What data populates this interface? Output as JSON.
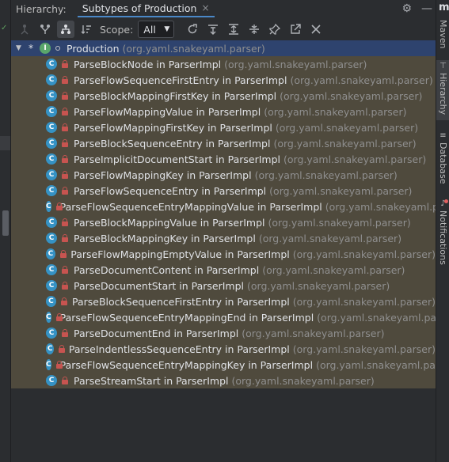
{
  "header": {
    "title_label": "Hierarchy:",
    "tab_label": "Subtypes of Production",
    "tab_close": "×",
    "settings_glyph": "⚙",
    "minimize_glyph": "—"
  },
  "toolbar": {
    "scope_label": "Scope:",
    "scope_value": "All",
    "scope_arrow": "▼"
  },
  "tree": {
    "root": {
      "name": "Production",
      "package": "(org.yaml.snakeyaml.parser)",
      "kind_letter": "I"
    },
    "class_letter": "C",
    "children": [
      {
        "name": "ParseBlockNode in ParserImpl",
        "package": "(org.yaml.snakeyaml.parser)"
      },
      {
        "name": "ParseFlowSequenceFirstEntry in ParserImpl",
        "package": "(org.yaml.snakeyaml.parser)"
      },
      {
        "name": "ParseBlockMappingFirstKey in ParserImpl",
        "package": "(org.yaml.snakeyaml.parser)"
      },
      {
        "name": "ParseFlowMappingValue in ParserImpl",
        "package": "(org.yaml.snakeyaml.parser)"
      },
      {
        "name": "ParseFlowMappingFirstKey in ParserImpl",
        "package": "(org.yaml.snakeyaml.parser)"
      },
      {
        "name": "ParseBlockSequenceEntry in ParserImpl",
        "package": "(org.yaml.snakeyaml.parser)"
      },
      {
        "name": "ParseImplicitDocumentStart in ParserImpl",
        "package": "(org.yaml.snakeyaml.parser)"
      },
      {
        "name": "ParseFlowMappingKey in ParserImpl",
        "package": "(org.yaml.snakeyaml.parser)"
      },
      {
        "name": "ParseFlowSequenceEntry in ParserImpl",
        "package": "(org.yaml.snakeyaml.parser)"
      },
      {
        "name": "ParseFlowSequenceEntryMappingValue in ParserImpl",
        "package": "(org.yaml.snakeyaml.pars"
      },
      {
        "name": "ParseBlockMappingValue in ParserImpl",
        "package": "(org.yaml.snakeyaml.parser)"
      },
      {
        "name": "ParseBlockMappingKey in ParserImpl",
        "package": "(org.yaml.snakeyaml.parser)"
      },
      {
        "name": "ParseFlowMappingEmptyValue in ParserImpl",
        "package": "(org.yaml.snakeyaml.parser)"
      },
      {
        "name": "ParseDocumentContent in ParserImpl",
        "package": "(org.yaml.snakeyaml.parser)"
      },
      {
        "name": "ParseDocumentStart in ParserImpl",
        "package": "(org.yaml.snakeyaml.parser)"
      },
      {
        "name": "ParseBlockSequenceFirstEntry in ParserImpl",
        "package": "(org.yaml.snakeyaml.parser)"
      },
      {
        "name": "ParseFlowSequenceEntryMappingEnd in ParserImpl",
        "package": "(org.yaml.snakeyaml.parse"
      },
      {
        "name": "ParseDocumentEnd in ParserImpl",
        "package": "(org.yaml.snakeyaml.parser)"
      },
      {
        "name": "ParseIndentlessSequenceEntry in ParserImpl",
        "package": "(org.yaml.snakeyaml.parser)"
      },
      {
        "name": "ParseFlowSequenceEntryMappingKey in ParserImpl",
        "package": "(org.yaml.snakeyaml.parse"
      },
      {
        "name": "ParseStreamStart in ParserImpl",
        "package": "(org.yaml.snakeyaml.parser)"
      }
    ]
  },
  "right_sidebar": {
    "top_label": "m",
    "items": [
      {
        "label": "Maven",
        "icon": "maven-icon"
      },
      {
        "label": "Hierarchy",
        "icon": "hierarchy-icon"
      },
      {
        "label": "Database",
        "icon": "database-icon"
      },
      {
        "label": "Notifications",
        "icon": "bell-icon"
      }
    ]
  },
  "colors": {
    "background": "#2b2d30",
    "selected_row": "#2e436e",
    "highlighted_row": "#4f4a3d",
    "class_icon": "#3592c4",
    "interface_icon": "#5aa66b",
    "lock": "#c75450",
    "package_text": "#8f8f8f"
  }
}
